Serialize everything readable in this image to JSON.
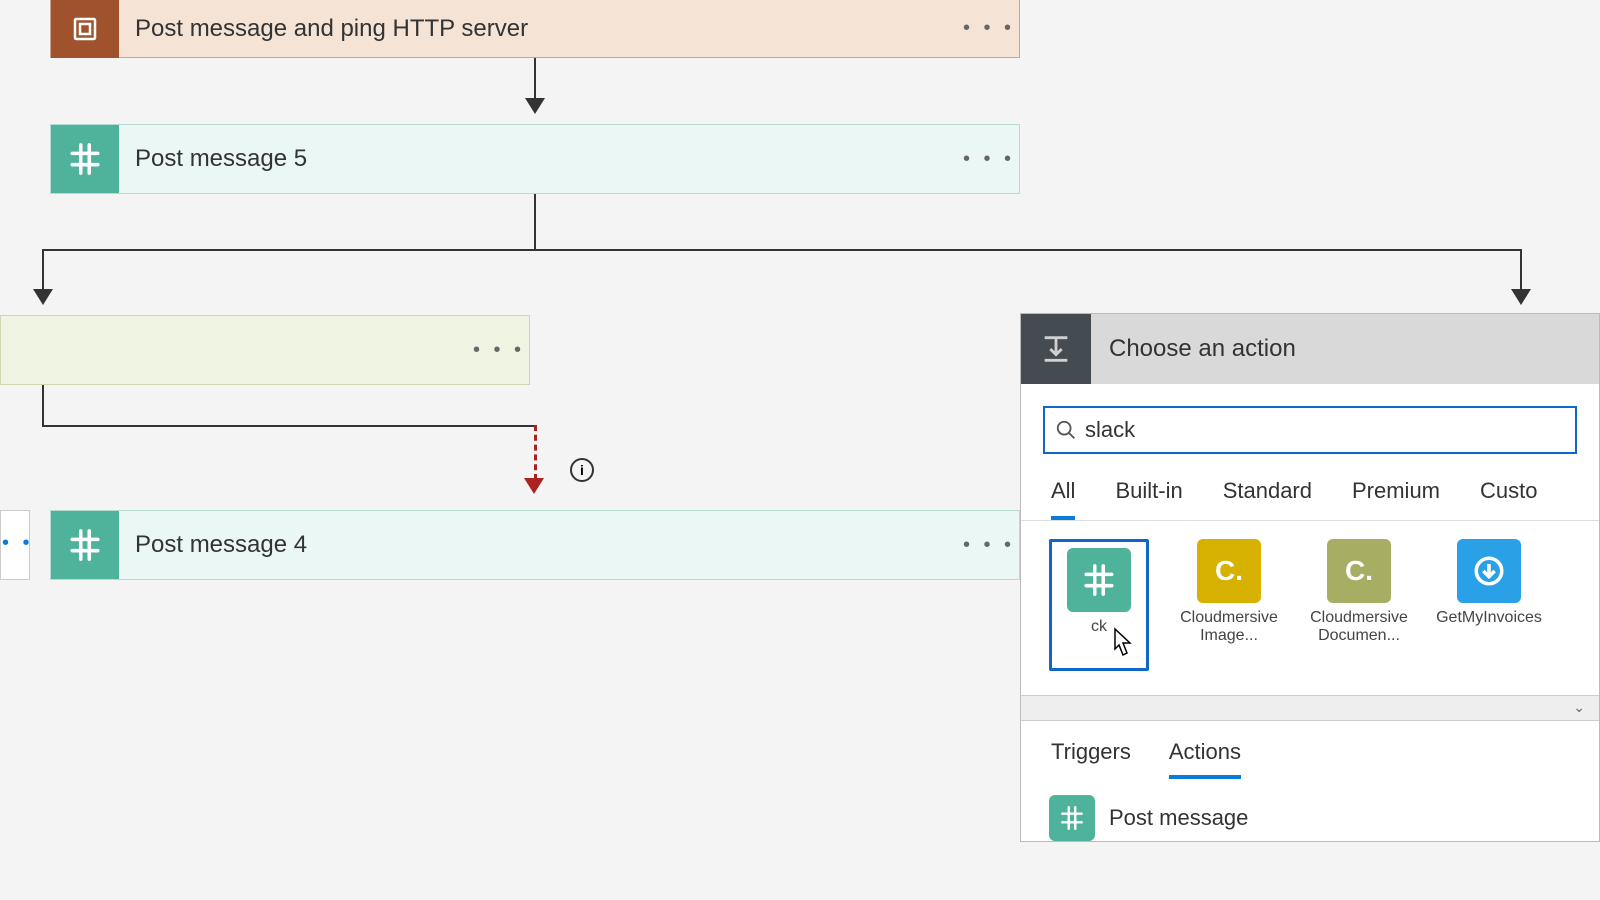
{
  "flow": {
    "step_scope": "Post message and ping HTTP server",
    "step_slack5": "Post message 5",
    "step_slack4": "Post message 4"
  },
  "panel": {
    "title": "Choose an action",
    "search_value": "slack",
    "tabs": [
      "All",
      "Built-in",
      "Standard",
      "Premium",
      "Custo"
    ],
    "active_tab": 0,
    "connectors": [
      {
        "name": "Slack",
        "short": "ck",
        "color": "#4fb29b",
        "kind": "slack"
      },
      {
        "name": "Cloudmersive Image...",
        "color": "#d6b100",
        "letter": "C."
      },
      {
        "name": "Cloudmersive Documen...",
        "color": "#a7ae63",
        "letter": "C."
      },
      {
        "name": "GetMyInvoices",
        "color": "#2aa0e6",
        "kind": "download"
      }
    ],
    "sub_tabs": [
      "Triggers",
      "Actions"
    ],
    "active_sub": 1,
    "result_0": "Post message"
  }
}
